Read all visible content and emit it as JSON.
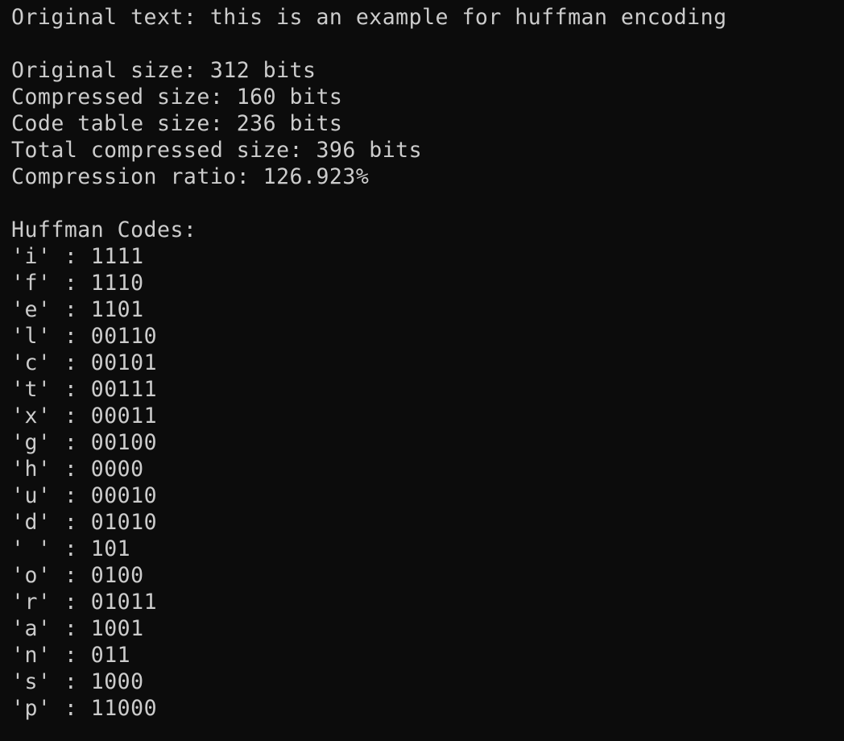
{
  "colors": {
    "background": "#0c0c0c",
    "text": "#cccccc"
  },
  "output": {
    "original_text_line": "Original text: this is an example for huffman encoding",
    "original_size_line": "Original size: 312 bits",
    "compressed_size_line": "Compressed size: 160 bits",
    "code_table_size_line": "Code table size: 236 bits",
    "total_compressed_size_line": "Total compressed size: 396 bits",
    "compression_ratio_line": "Compression ratio: 126.923%",
    "codes_header": "Huffman Codes:",
    "codes": [
      {
        "symbol": "'i'",
        "sep": " : ",
        "code": "1111"
      },
      {
        "symbol": "'f'",
        "sep": " : ",
        "code": "1110"
      },
      {
        "symbol": "'e'",
        "sep": " : ",
        "code": "1101"
      },
      {
        "symbol": "'l'",
        "sep": " : ",
        "code": "00110"
      },
      {
        "symbol": "'c'",
        "sep": " : ",
        "code": "00101"
      },
      {
        "symbol": "'t'",
        "sep": " : ",
        "code": "00111"
      },
      {
        "symbol": "'x'",
        "sep": " : ",
        "code": "00011"
      },
      {
        "symbol": "'g'",
        "sep": " : ",
        "code": "00100"
      },
      {
        "symbol": "'h'",
        "sep": " : ",
        "code": "0000"
      },
      {
        "symbol": "'u'",
        "sep": " : ",
        "code": "00010"
      },
      {
        "symbol": "'d'",
        "sep": " : ",
        "code": "01010"
      },
      {
        "symbol": "' '",
        "sep": " : ",
        "code": "101"
      },
      {
        "symbol": "'o'",
        "sep": " : ",
        "code": "0100"
      },
      {
        "symbol": "'r'",
        "sep": " : ",
        "code": "01011"
      },
      {
        "symbol": "'a'",
        "sep": " : ",
        "code": "1001"
      },
      {
        "symbol": "'n'",
        "sep": " : ",
        "code": "011"
      },
      {
        "symbol": "'s'",
        "sep": " : ",
        "code": "1000"
      },
      {
        "symbol": "'p'",
        "sep": " : ",
        "code": "11000"
      }
    ]
  }
}
